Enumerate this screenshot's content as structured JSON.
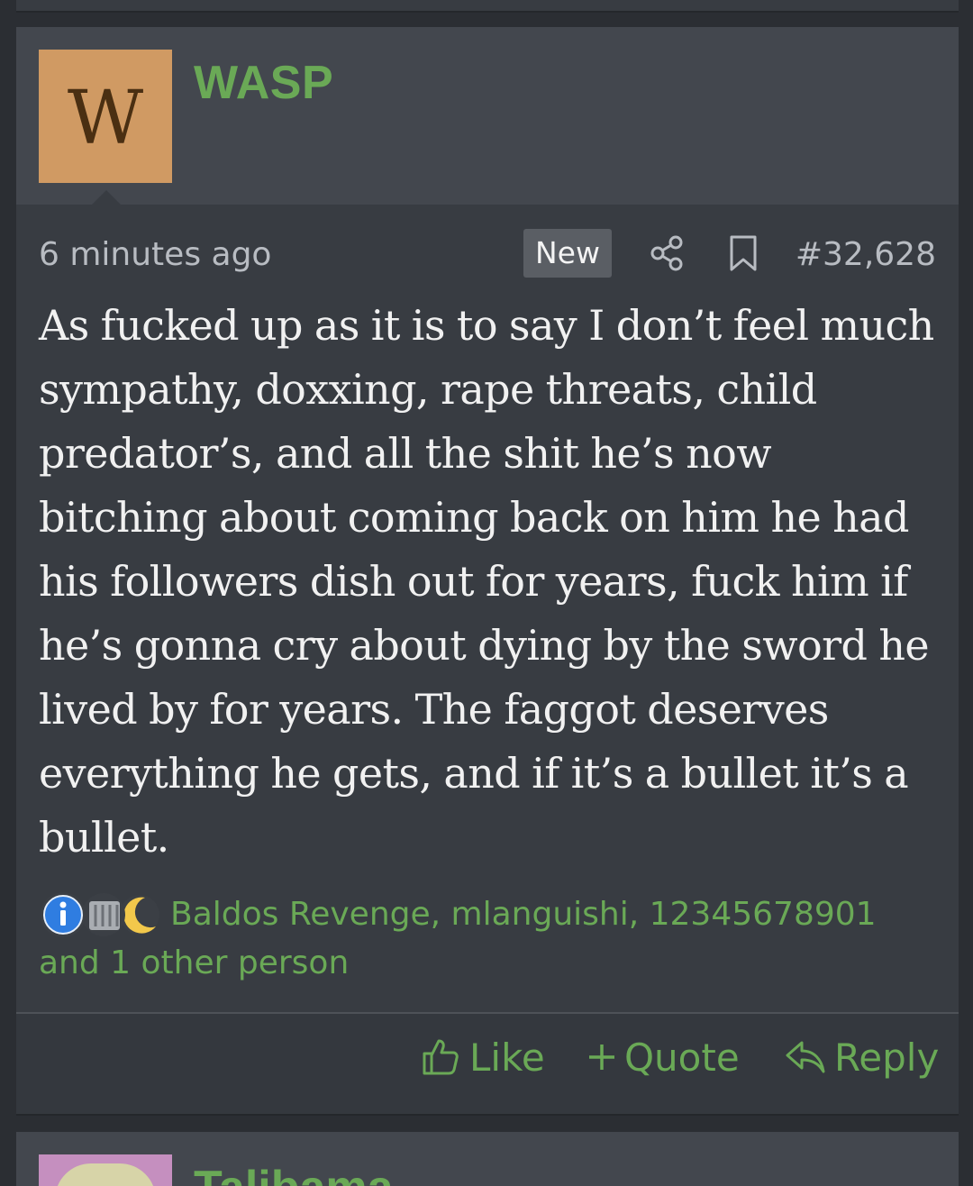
{
  "post": {
    "avatar_letter": "W",
    "username": "WASP",
    "timestamp": "6 minutes ago",
    "badge": "New",
    "share_icon": "share-icon",
    "bookmark_icon": "bookmark-icon",
    "post_number": "#32,628",
    "body": "As fucked up as it is to say I don’t feel much sympathy, doxxing, rape threats, child predator’s, and all the shit he’s now bitching about coming back on him he had his followers dish out for years, fuck him if he’s gonna cry about dying by the sword he lived by for years. The faggot deserves everything he gets, and if it’s a bullet it’s a bullet.",
    "reactions": {
      "icons": [
        "informative-icon",
        "dumpster-fire-icon",
        "moon-icon"
      ],
      "users": "Baldos Revenge, mlanguishi, 12345678901",
      "others": "and 1 other person"
    },
    "actions": {
      "like": "Like",
      "quote": "Quote",
      "reply": "Reply"
    }
  },
  "next_post": {
    "username_partial": "Talibama"
  },
  "colors": {
    "background": "#2b2e33",
    "post_bg": "#383c42",
    "header_bg": "#43474e",
    "accent_green": "#6aa956",
    "avatar_bg": "#d09a63"
  }
}
